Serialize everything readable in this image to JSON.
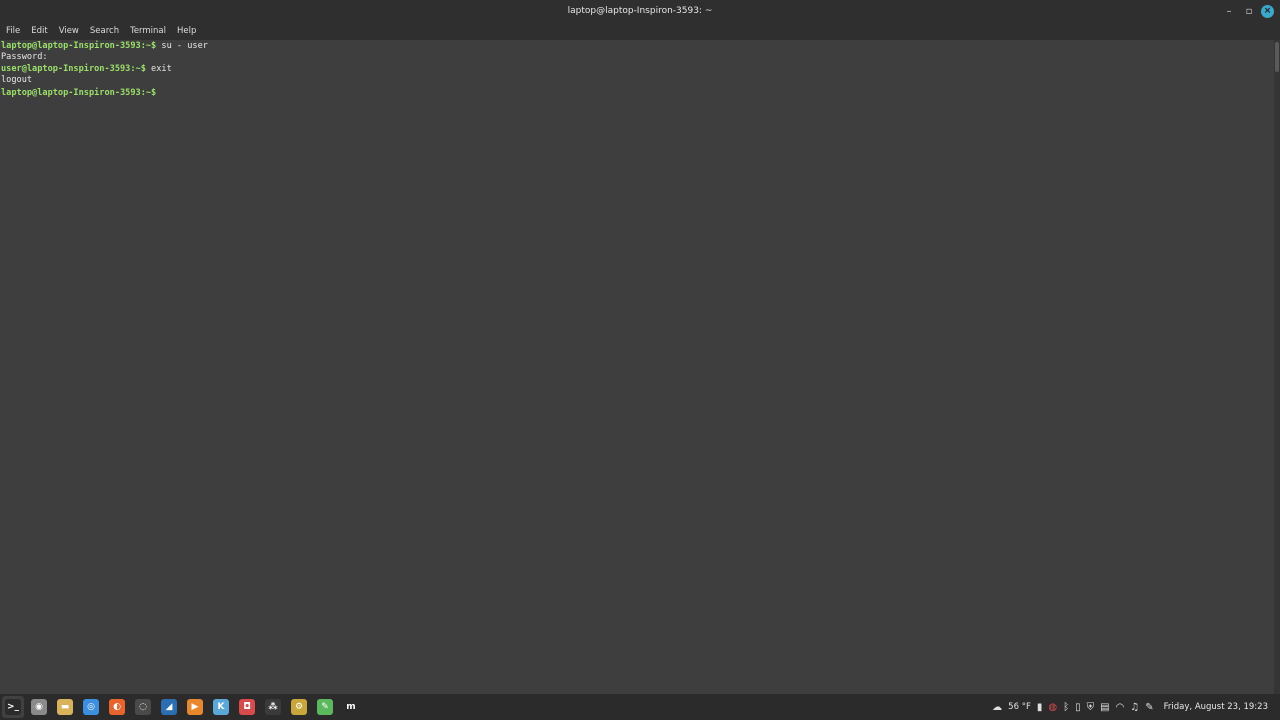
{
  "window": {
    "title": "laptop@laptop-Inspiron-3593: ~",
    "controls": {
      "minimize": "–",
      "maximize": "▫",
      "close": "×"
    }
  },
  "menubar": {
    "items": [
      "File",
      "Edit",
      "View",
      "Search",
      "Terminal",
      "Help"
    ]
  },
  "terminal": {
    "lines": [
      {
        "prompt": "laptop@laptop-Inspiron-3593:~$",
        "text": " su - user"
      },
      {
        "prompt": "",
        "text": "Password:"
      },
      {
        "prompt": "user@laptop-Inspiron-3593:~$",
        "text": " exit"
      },
      {
        "prompt": "",
        "text": "logout"
      },
      {
        "prompt": "laptop@laptop-Inspiron-3593:~$",
        "text": " "
      }
    ]
  },
  "taskbar": {
    "launchers": [
      {
        "name": "terminal-launcher",
        "icon": "terminal-icon",
        "glyph": ">_",
        "color": "#2b2b2b",
        "active": true
      },
      {
        "name": "disk-launcher",
        "icon": "disk-icon",
        "glyph": "◉",
        "color": "#8a8a8a",
        "active": false
      },
      {
        "name": "files-launcher",
        "icon": "folder-icon",
        "glyph": "▬",
        "color": "#d9b35c",
        "active": false
      },
      {
        "name": "chrome-launcher",
        "icon": "chrome-icon",
        "glyph": "◎",
        "color": "#3b8ee0",
        "active": false
      },
      {
        "name": "firefox-launcher",
        "icon": "firefox-icon",
        "glyph": "◐",
        "color": "#e8642c",
        "active": false
      },
      {
        "name": "obs-launcher",
        "icon": "obs-icon",
        "glyph": "◌",
        "color": "#4a4a4a",
        "active": false
      },
      {
        "name": "steam-launcher",
        "icon": "steam-icon",
        "glyph": "◢",
        "color": "#2a6fb3",
        "active": false
      },
      {
        "name": "vlc-launcher",
        "icon": "play-icon",
        "glyph": "▶",
        "color": "#e8872c",
        "active": false
      },
      {
        "name": "kdenlive-launcher",
        "icon": "kdenlive-icon",
        "glyph": "K",
        "color": "#5aa8d8",
        "active": false
      },
      {
        "name": "app-launcher",
        "icon": "app-icon",
        "glyph": "◘",
        "color": "#d94a4a",
        "active": false
      },
      {
        "name": "clapper-launcher",
        "icon": "clapper-icon",
        "glyph": "⁂",
        "color": "#3a3a3a",
        "active": false
      },
      {
        "name": "settings-launcher",
        "icon": "gear-icon",
        "glyph": "⚙",
        "color": "#c9a63c",
        "active": false
      },
      {
        "name": "editor-launcher",
        "icon": "pen-icon",
        "glyph": "✎",
        "color": "#5cb85c",
        "active": false
      },
      {
        "name": "mint-launcher",
        "icon": "mint-icon",
        "glyph": "m",
        "color": "#2b2b2b",
        "active": false
      }
    ],
    "tray": {
      "weather_icon": "weather-icon",
      "temperature": "56 °F",
      "clock": "Friday, August 23, 19:23"
    }
  }
}
